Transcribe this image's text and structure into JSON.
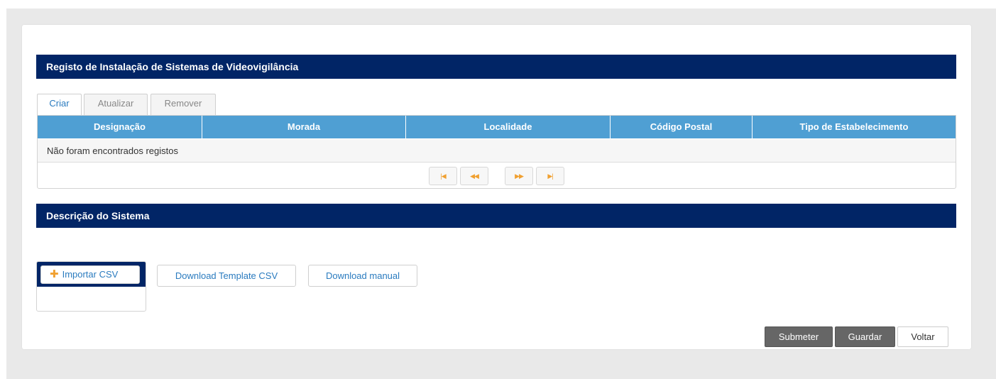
{
  "sections": {
    "registo_title": "Registo de Instalação de Sistemas de Videovigilância",
    "descricao_title": "Descrição do Sistema"
  },
  "tabs": [
    {
      "label": "Criar",
      "active": true
    },
    {
      "label": "Atualizar",
      "active": false
    },
    {
      "label": "Remover",
      "active": false
    }
  ],
  "table": {
    "columns": [
      "Designação",
      "Morada",
      "Localidade",
      "Código Postal",
      "Tipo de Estabelecimento"
    ],
    "empty_message": "Não foram encontrados registos"
  },
  "pager": {
    "first": "|◀",
    "prev": "◀◀",
    "next": "▶▶",
    "last": "▶|"
  },
  "import": {
    "icon": "plus-icon",
    "label": "Importar CSV"
  },
  "downloads": {
    "template_label": "Download Template CSV",
    "manual_label": "Download manual"
  },
  "actions": {
    "submit_label": "Submeter",
    "save_label": "Guardar",
    "back_label": "Voltar"
  },
  "colors": {
    "header_navy": "#012566",
    "table_head_blue": "#4f9fd3",
    "link_blue": "#2a7bbf",
    "accent_orange": "#f0a030",
    "button_gray": "#666666"
  }
}
